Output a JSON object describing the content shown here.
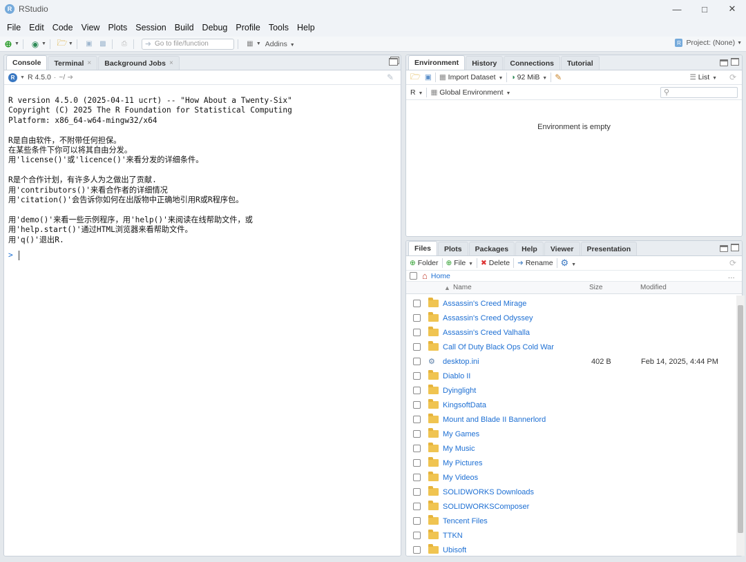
{
  "window": {
    "title": "RStudio",
    "logo_letter": "R"
  },
  "menu": [
    "File",
    "Edit",
    "Code",
    "View",
    "Plots",
    "Session",
    "Build",
    "Debug",
    "Profile",
    "Tools",
    "Help"
  ],
  "toolbar": {
    "goto_placeholder": "Go to file/function",
    "addins_label": "Addins",
    "project_label": "Project: (None)"
  },
  "console": {
    "tabs": [
      {
        "label": "Console",
        "active": true,
        "closable": false
      },
      {
        "label": "Terminal",
        "active": false,
        "closable": true
      },
      {
        "label": "Background Jobs",
        "active": false,
        "closable": true
      }
    ],
    "r_version_label": "R 4.5.0",
    "working_dir": "~/",
    "lines": [
      "R version 4.5.0 (2025-04-11 ucrt) -- \"How About a Twenty-Six\"",
      "Copyright (C) 2025 The R Foundation for Statistical Computing",
      "Platform: x86_64-w64-mingw32/x64",
      "",
      "R是自由软件，不附带任何担保。",
      "在某些条件下你可以将其自由分发。",
      "用'license()'或'licence()'来看分发的详细条件。",
      "",
      "R是个合作计划，有许多人为之做出了贡献.",
      "用'contributors()'来看合作者的详细情况",
      "用'citation()'会告诉你如何在出版物中正确地引用R或R程序包。",
      "",
      "用'demo()'来看一些示例程序，用'help()'来阅读在线帮助文件，或",
      "用'help.start()'通过HTML浏览器来看帮助文件。",
      "用'q()'退出R."
    ],
    "prompt": ">"
  },
  "environment": {
    "tabs": [
      {
        "label": "Environment",
        "active": true
      },
      {
        "label": "History",
        "active": false
      },
      {
        "label": "Connections",
        "active": false
      },
      {
        "label": "Tutorial",
        "active": false
      }
    ],
    "import_label": "Import Dataset",
    "memory_label": "92 MiB",
    "view_mode": "List",
    "language": "R",
    "scope": "Global Environment",
    "empty_message": "Environment is empty"
  },
  "files": {
    "tabs": [
      {
        "label": "Files",
        "active": true
      },
      {
        "label": "Plots",
        "active": false
      },
      {
        "label": "Packages",
        "active": false
      },
      {
        "label": "Help",
        "active": false
      },
      {
        "label": "Viewer",
        "active": false
      },
      {
        "label": "Presentation",
        "active": false
      }
    ],
    "actions": {
      "folder": "Folder",
      "file": "File",
      "delete": "Delete",
      "rename": "Rename"
    },
    "breadcrumb": "Home",
    "columns": {
      "name": "Name",
      "size": "Size",
      "modified": "Modified"
    },
    "rows": [
      {
        "name": "Assassin's Creed Mirage",
        "type": "folder",
        "size": "",
        "modified": ""
      },
      {
        "name": "Assassin's Creed Odyssey",
        "type": "folder",
        "size": "",
        "modified": ""
      },
      {
        "name": "Assassin's Creed Valhalla",
        "type": "folder",
        "size": "",
        "modified": ""
      },
      {
        "name": "Call Of Duty Black Ops Cold War",
        "type": "folder",
        "size": "",
        "modified": ""
      },
      {
        "name": "desktop.ini",
        "type": "file",
        "size": "402 B",
        "modified": "Feb 14, 2025, 4:44 PM"
      },
      {
        "name": "Diablo II",
        "type": "folder",
        "size": "",
        "modified": ""
      },
      {
        "name": "Dyinglight",
        "type": "folder",
        "size": "",
        "modified": ""
      },
      {
        "name": "KingsoftData",
        "type": "folder",
        "size": "",
        "modified": ""
      },
      {
        "name": "Mount and Blade II Bannerlord",
        "type": "folder",
        "size": "",
        "modified": ""
      },
      {
        "name": "My Games",
        "type": "folder",
        "size": "",
        "modified": ""
      },
      {
        "name": "My Music",
        "type": "folder",
        "size": "",
        "modified": ""
      },
      {
        "name": "My Pictures",
        "type": "folder",
        "size": "",
        "modified": ""
      },
      {
        "name": "My Videos",
        "type": "folder",
        "size": "",
        "modified": ""
      },
      {
        "name": "SOLIDWORKS Downloads",
        "type": "folder",
        "size": "",
        "modified": ""
      },
      {
        "name": "SOLIDWORKSComposer",
        "type": "folder",
        "size": "",
        "modified": ""
      },
      {
        "name": "Tencent Files",
        "type": "folder",
        "size": "",
        "modified": ""
      },
      {
        "name": "TTKN",
        "type": "folder",
        "size": "",
        "modified": ""
      },
      {
        "name": "Ubisoft",
        "type": "folder",
        "size": "",
        "modified": ""
      }
    ]
  },
  "colors": {
    "accent": "#1d6fd3",
    "folder": "#f0c451",
    "r_logo": "#75aadb"
  }
}
